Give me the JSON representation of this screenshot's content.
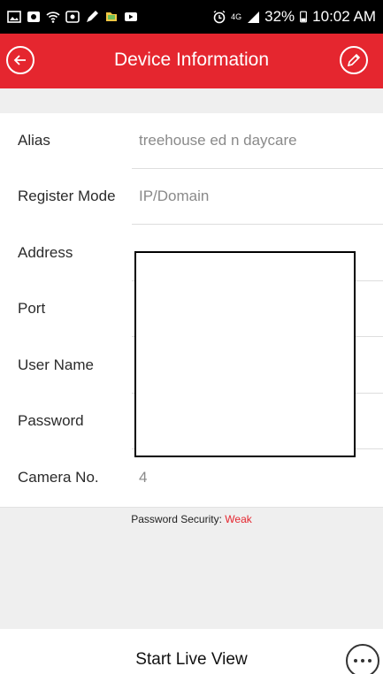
{
  "status_bar": {
    "network": "4G",
    "battery": "32%",
    "time": "10:02 AM",
    "icons_left": [
      "gallery-icon",
      "camera-icon",
      "wifi-icon",
      "photo-icon",
      "pen-icon",
      "files-icon",
      "video-icon"
    ],
    "icons_right": [
      "alarm-icon",
      "signal-icon",
      "battery-icon"
    ]
  },
  "header": {
    "title": "Device Information",
    "back_icon": "back-arrow-icon",
    "edit_icon": "edit-pencil-icon",
    "color": "#e5262f"
  },
  "fields": [
    {
      "label": "Alias",
      "value": "treehouse ed n daycare"
    },
    {
      "label": "Register Mode",
      "value": "IP/Domain"
    },
    {
      "label": "Address",
      "value": ""
    },
    {
      "label": "Port",
      "value": ""
    },
    {
      "label": "User Name",
      "value": ""
    },
    {
      "label": "Password",
      "value": ""
    },
    {
      "label": "Camera No.",
      "value": "4"
    }
  ],
  "security": {
    "label": "Password Security:",
    "value": "Weak",
    "value_color": "#e5262f"
  },
  "footer": {
    "live_view_label": "Start Live View",
    "more_icon": "more-options-icon"
  }
}
